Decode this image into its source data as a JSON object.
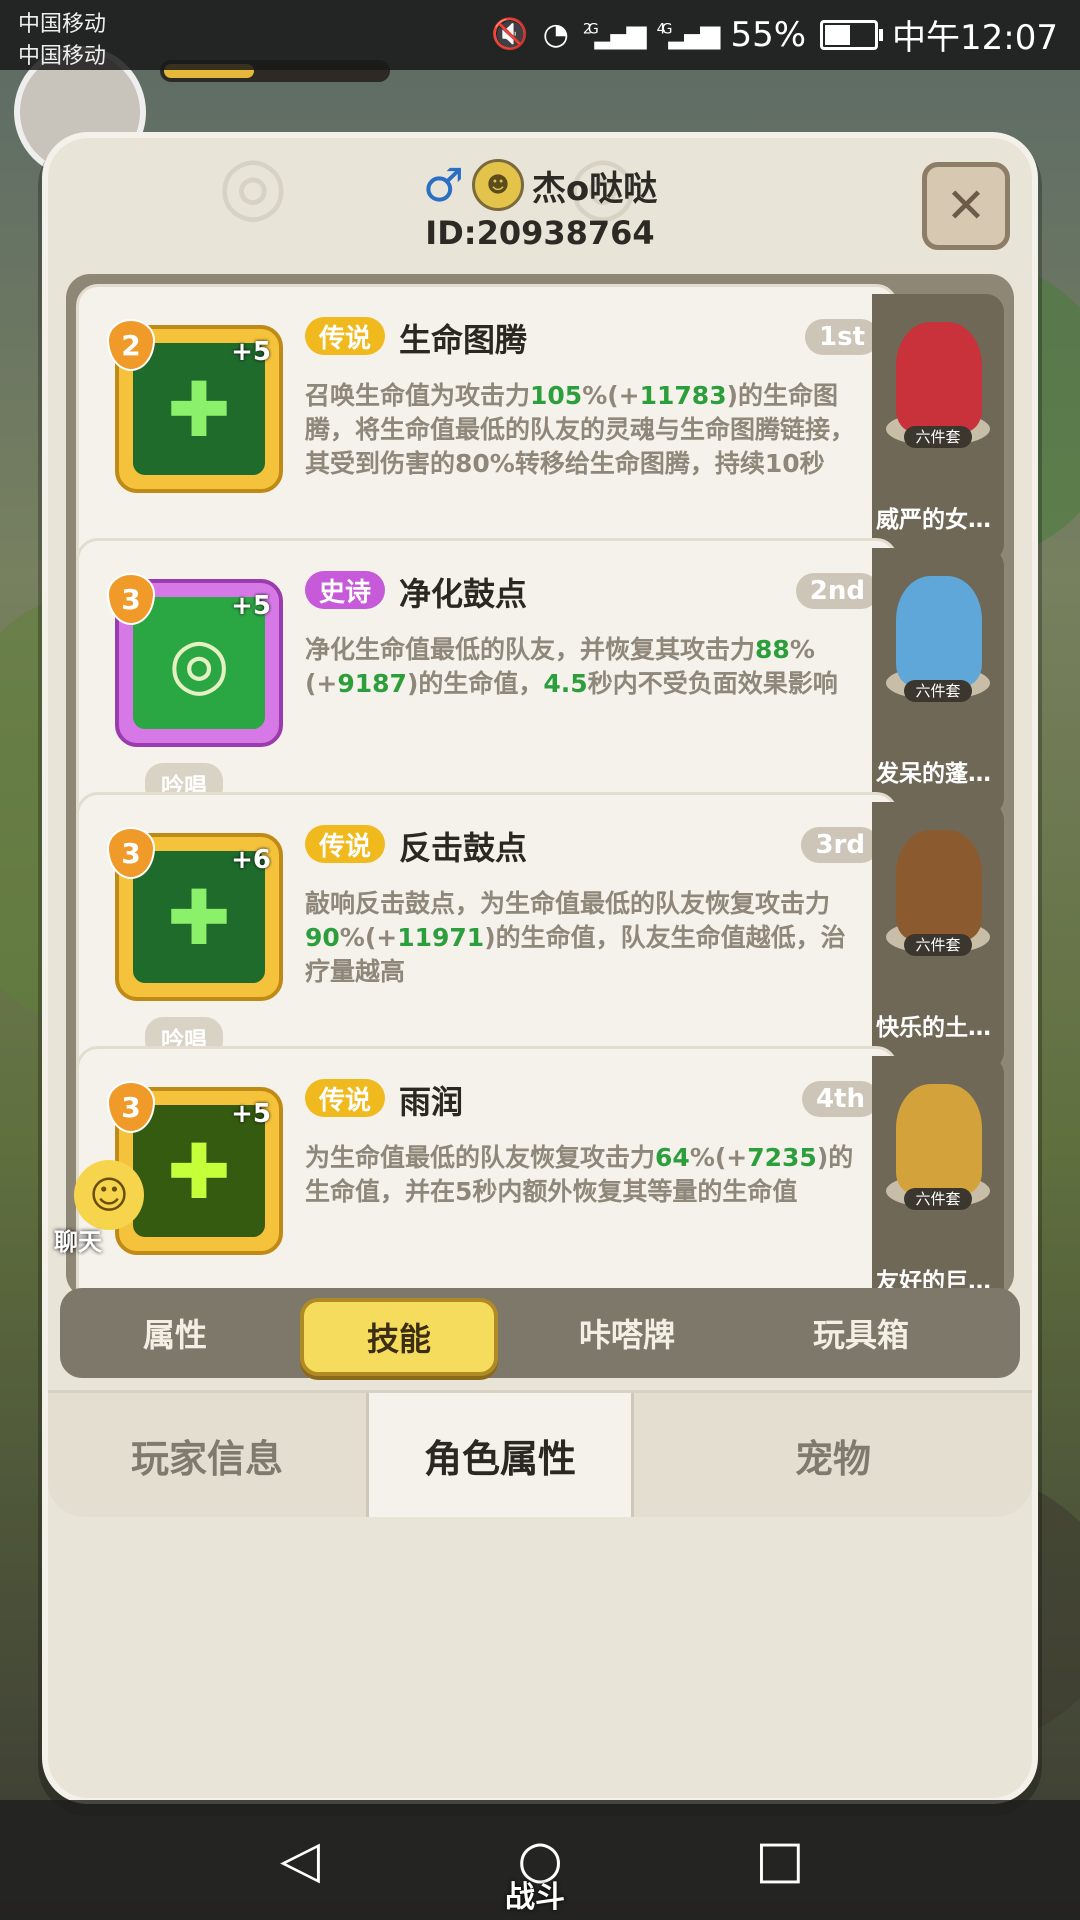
{
  "status_bar": {
    "carrier1": "中国移动",
    "carrier2": "中国移动",
    "net_2g": "2G",
    "net_4g": "4G",
    "battery": "55%",
    "battery_level": 0.55,
    "time": "中午12:07"
  },
  "player": {
    "gender_icon": "male-icon",
    "name": "杰o哒哒",
    "id": "ID:20938764"
  },
  "skills": [
    {
      "level": "2",
      "plus": "+5",
      "rarity": "传说",
      "title": "生命图腾",
      "order": "1st",
      "desc_parts": [
        "召唤生命值为攻击力",
        "105",
        "%(+",
        "11783",
        ")的生命图腾，将生命值最低的队友的灵魂与生命图腾链接，其受到伤害的80%转移给生命图腾，持续10秒"
      ],
      "tag": "",
      "pet_set": "六件套",
      "pet_name": "威严的女…"
    },
    {
      "level": "3",
      "plus": "+5",
      "rarity": "史诗",
      "title": "净化鼓点",
      "order": "2nd",
      "desc_parts": [
        "净化生命值最低的队友，并恢复其攻击力",
        "88",
        "%(+",
        "9187",
        ")的生命值，",
        "4.5",
        "秒内不受负面效果影响"
      ],
      "tag": "吟唱",
      "pet_set": "六件套",
      "pet_name": "发呆的蓬…"
    },
    {
      "level": "3",
      "plus": "+6",
      "rarity": "传说",
      "title": "反击鼓点",
      "order": "3rd",
      "desc_parts": [
        "敲响反击鼓点，为生命值最低的队友恢复攻击力",
        "90",
        "%(+",
        "11971",
        ")的生命值，队友生命值越低，治疗量越高"
      ],
      "tag": "吟唱",
      "pet_set": "六件套",
      "pet_name": "快乐的土…"
    },
    {
      "level": "3",
      "plus": "+5",
      "rarity": "传说",
      "title": "雨润",
      "order": "4th",
      "desc_parts": [
        "为生命值最低的队友恢复攻击力",
        "64",
        "%(+",
        "7235",
        ")的生命值，并在5秒内额外恢复其等量的生命值"
      ],
      "tag": "",
      "pet_set": "六件套",
      "pet_name": "友好的巨…"
    }
  ],
  "sub_tabs": [
    "属性",
    "技能",
    "咔嗒牌",
    "玩具箱"
  ],
  "active_sub_tab": "技能",
  "bottom_tabs": [
    "玩家信息",
    "角色属性",
    "宠物"
  ],
  "active_bottom_tab": "角色属性",
  "chat": {
    "label": "聊天"
  },
  "nav": {
    "battle_label": "战斗"
  },
  "colors": {
    "legend": "#f0b91e",
    "epic": "#c65ad9",
    "highlight_number": "#2c9e3c"
  }
}
